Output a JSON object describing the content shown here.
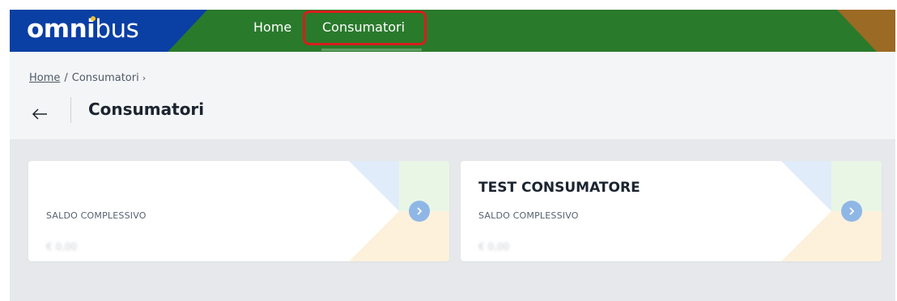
{
  "app": {
    "logo_bold": "omni",
    "logo_regular": "bus"
  },
  "nav": {
    "items": [
      {
        "label": "Home"
      },
      {
        "label": "Consumatori",
        "highlighted": true
      }
    ]
  },
  "breadcrumb": {
    "items": [
      {
        "label": "Home"
      },
      {
        "label": "Consumatori"
      }
    ],
    "separator": "/",
    "trailing": "›"
  },
  "header": {
    "title": "Consumatori"
  },
  "cards": [
    {
      "title": "",
      "label": "SALDO COMPLESSIVO",
      "value": "€ 0,00"
    },
    {
      "title": "TEST CONSUMATORE",
      "label": "SALDO COMPLESSIVO",
      "value": "€ 0,00"
    }
  ],
  "colors": {
    "nav_green": "#2a7a2c",
    "nav_blue": "#0a3fa4",
    "nav_brown": "#9b6a24",
    "highlight_red": "#d81d1d",
    "arrow_blue": "#8fb7e6"
  },
  "icons": {
    "back": "arrow-left-icon",
    "card_action": "chevron-right-icon"
  }
}
